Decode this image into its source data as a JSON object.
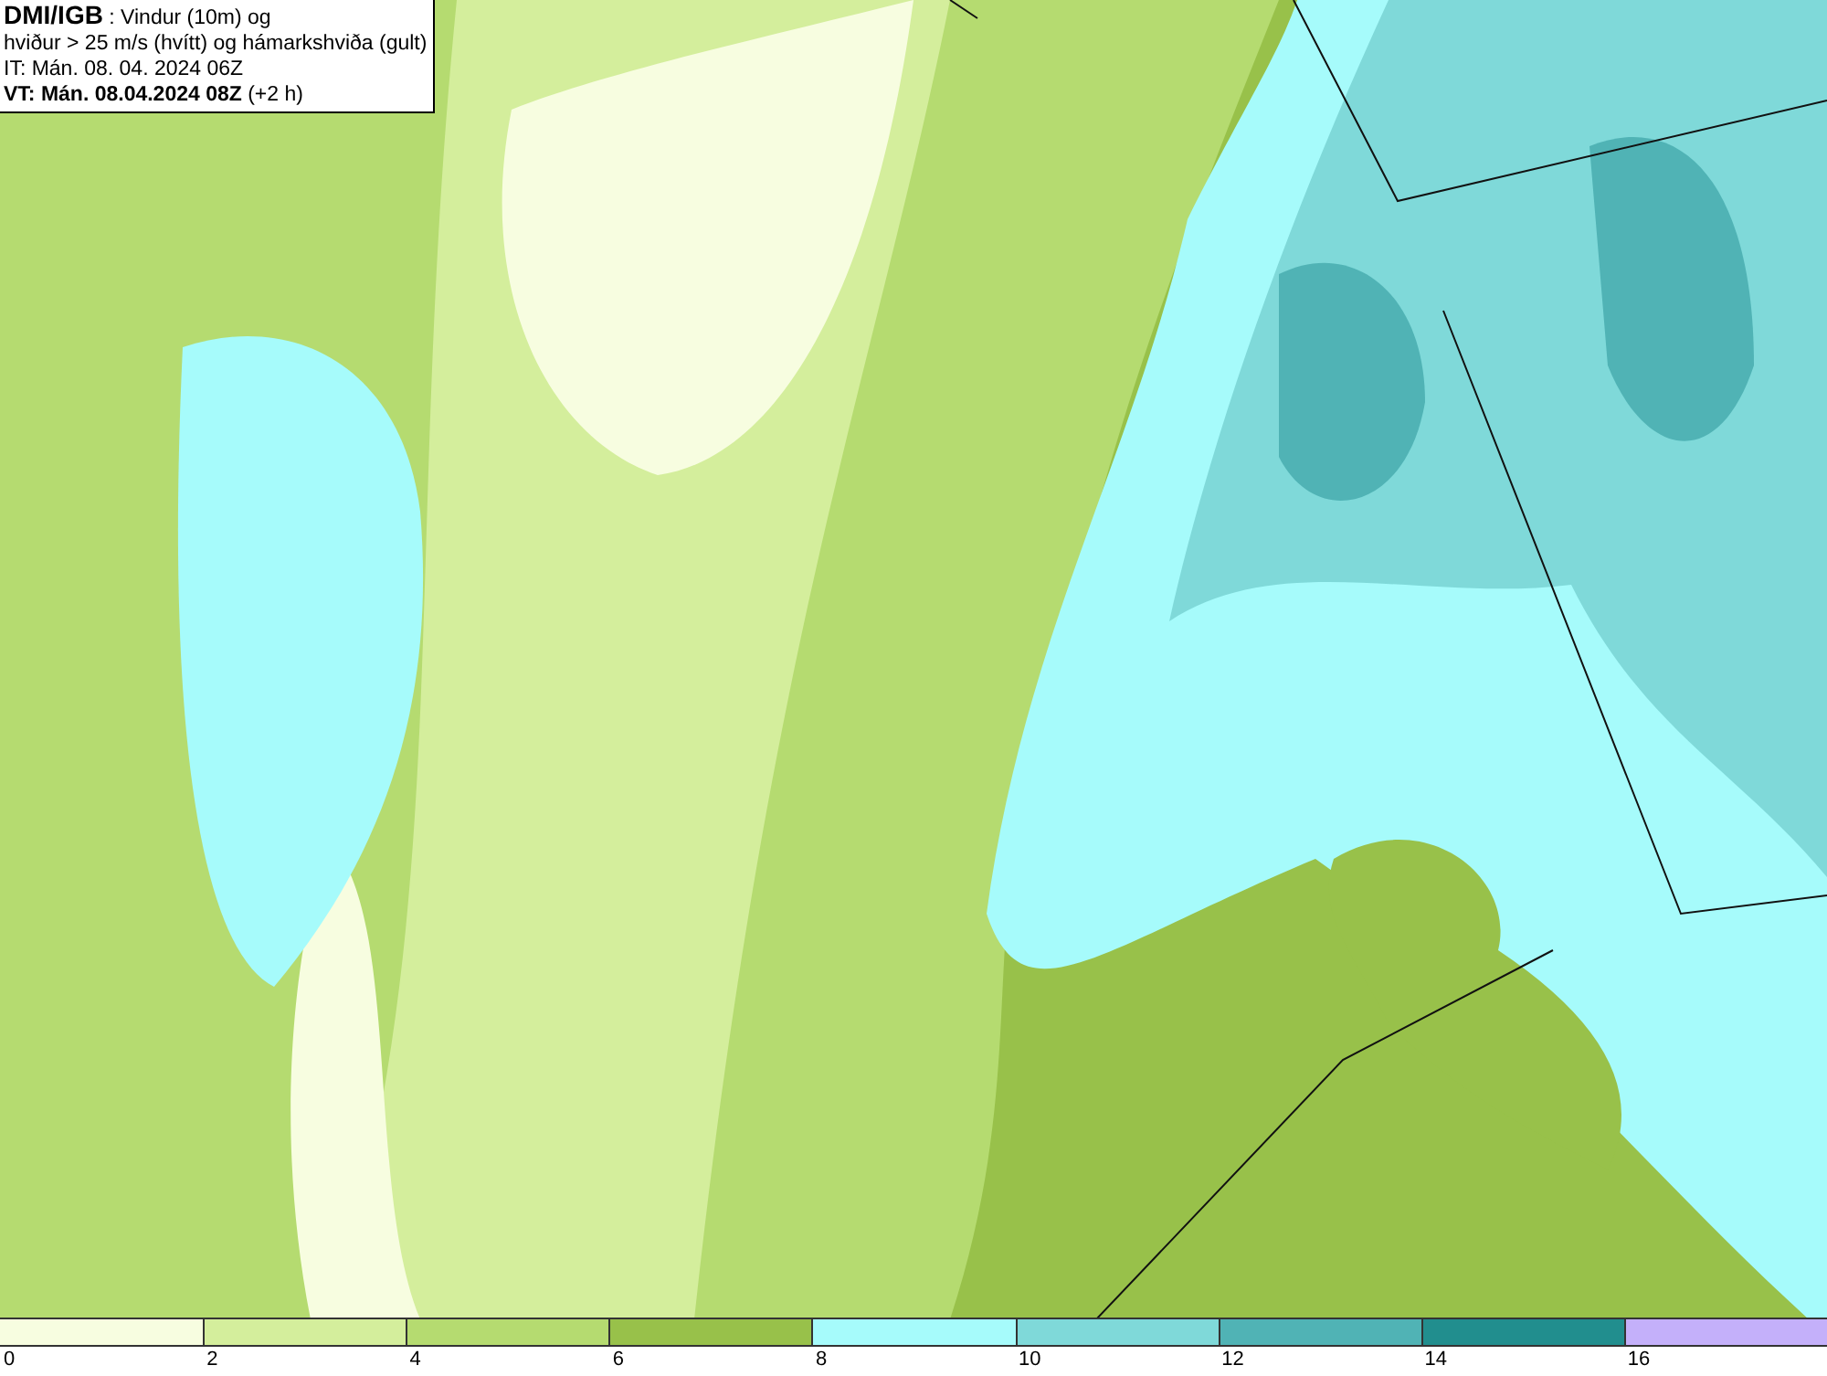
{
  "info_box": {
    "lines": [
      "**DMI/IGB** : Vindur (10m) og",
      "hviður > 25 m/s (hvítt) og hámarkshviða (gult)",
      "IT: Mán. 08. 04. 2024 06Z",
      "**VT: Mán. 08.04.2024 08Z** (+2 h)"
    ]
  },
  "legend": {
    "segments": [
      {
        "color": "#f7fde0",
        "label": "0"
      },
      {
        "color": "#d4ee9c",
        "label": "2"
      },
      {
        "color": "#b5db70",
        "label": "4"
      },
      {
        "color": "#98c14a",
        "label": "6"
      },
      {
        "color": "#a6fbfb",
        "label": "8"
      },
      {
        "color": "#7fd9d9",
        "label": "10"
      },
      {
        "color": "#50b3b5",
        "label": "12"
      },
      {
        "color": "#218e8e",
        "label": "14"
      },
      {
        "color": "#c4b0fa",
        "label": "16"
      }
    ]
  }
}
